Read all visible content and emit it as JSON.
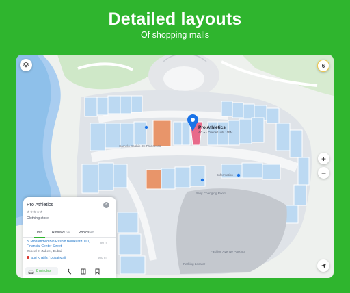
{
  "promo": {
    "headline": "Detailed layouts",
    "subline": "Of shopping malls"
  },
  "map": {
    "floor_indicator": "6",
    "zoom_in": "+",
    "zoom_out": "−",
    "labels": {
      "store_a": "Camelo Sophie De Francesco",
      "information": "Information",
      "baby_changing": "Baby Changing Room",
      "parking": "Parking Locator",
      "fashion_parking": "Fashion Avenue Parking"
    }
  },
  "pin": {
    "title": "Pro Athletics",
    "subtitle": "4.0 ★ · Opened until 10PM"
  },
  "card": {
    "title": "Pro Athletics",
    "close": "×",
    "stars": "★★★★★",
    "category": "Clothing store",
    "tabs": [
      {
        "label": "Info",
        "count": ""
      },
      {
        "label": "Reviews",
        "count": "64"
      },
      {
        "label": "Photos",
        "count": "48"
      }
    ],
    "address_line": "3, Mohammed Bin Rashid Boulevard 100, Financial Center Street",
    "address_distance": "80 m",
    "district": "Zabeel 2, Zabeel, Dubai",
    "metro": "Burj Khalifa / Dubai Mall",
    "metro_distance": "500 m",
    "route_time": "8 minutes"
  },
  "colors": {
    "brand_green": "#2fb52e",
    "store_blue": "#bcd9f2",
    "highlight_orange": "#e8956a",
    "highlight_pink": "#e86a8a",
    "pin_blue": "#1a73e8"
  }
}
